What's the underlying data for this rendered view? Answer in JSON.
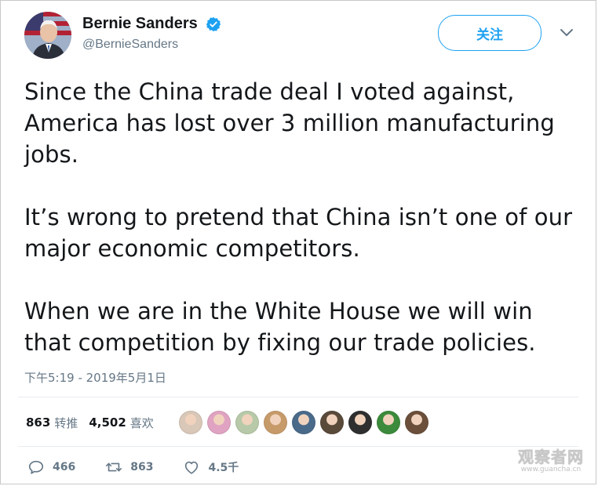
{
  "author": {
    "display_name": "Bernie Sanders",
    "handle": "@BernieSanders",
    "verified": true
  },
  "header": {
    "follow_label": "关注"
  },
  "tweet": {
    "paragraphs": [
      "Since the China trade deal I voted against, America has lost over 3 million manufacturing jobs.",
      "It’s wrong to pretend that China isn’t one of our major economic competitors.",
      "When we are in the White House we will win that competition by fixing our trade policies."
    ],
    "timestamp": "下午5:19 - 2019年5月1日"
  },
  "stats": {
    "retweets_count": "863",
    "retweets_label": "转推",
    "likes_count": "4,502",
    "likes_label": "喜欢"
  },
  "likers": [
    {
      "name": "liker-1",
      "color": "#d9c7b8"
    },
    {
      "name": "liker-2",
      "color": "#e0a3c2"
    },
    {
      "name": "liker-3",
      "color": "#b7c9a8"
    },
    {
      "name": "liker-4",
      "color": "#c79a6a"
    },
    {
      "name": "liker-5",
      "color": "#4a6a8a"
    },
    {
      "name": "liker-6",
      "color": "#5a4a3a"
    },
    {
      "name": "liker-7",
      "color": "#2f2f2f"
    },
    {
      "name": "liker-8",
      "color": "#3c8a3c"
    },
    {
      "name": "liker-9",
      "color": "#6b4f3a"
    }
  ],
  "actions": {
    "replies": "466",
    "retweets": "863",
    "likes": "4.5千"
  },
  "watermark": {
    "main": "观察者网",
    "sub": "www.guancha.cn"
  },
  "colors": {
    "accent": "#1da1f2",
    "muted": "#657786",
    "text": "#14171a"
  }
}
